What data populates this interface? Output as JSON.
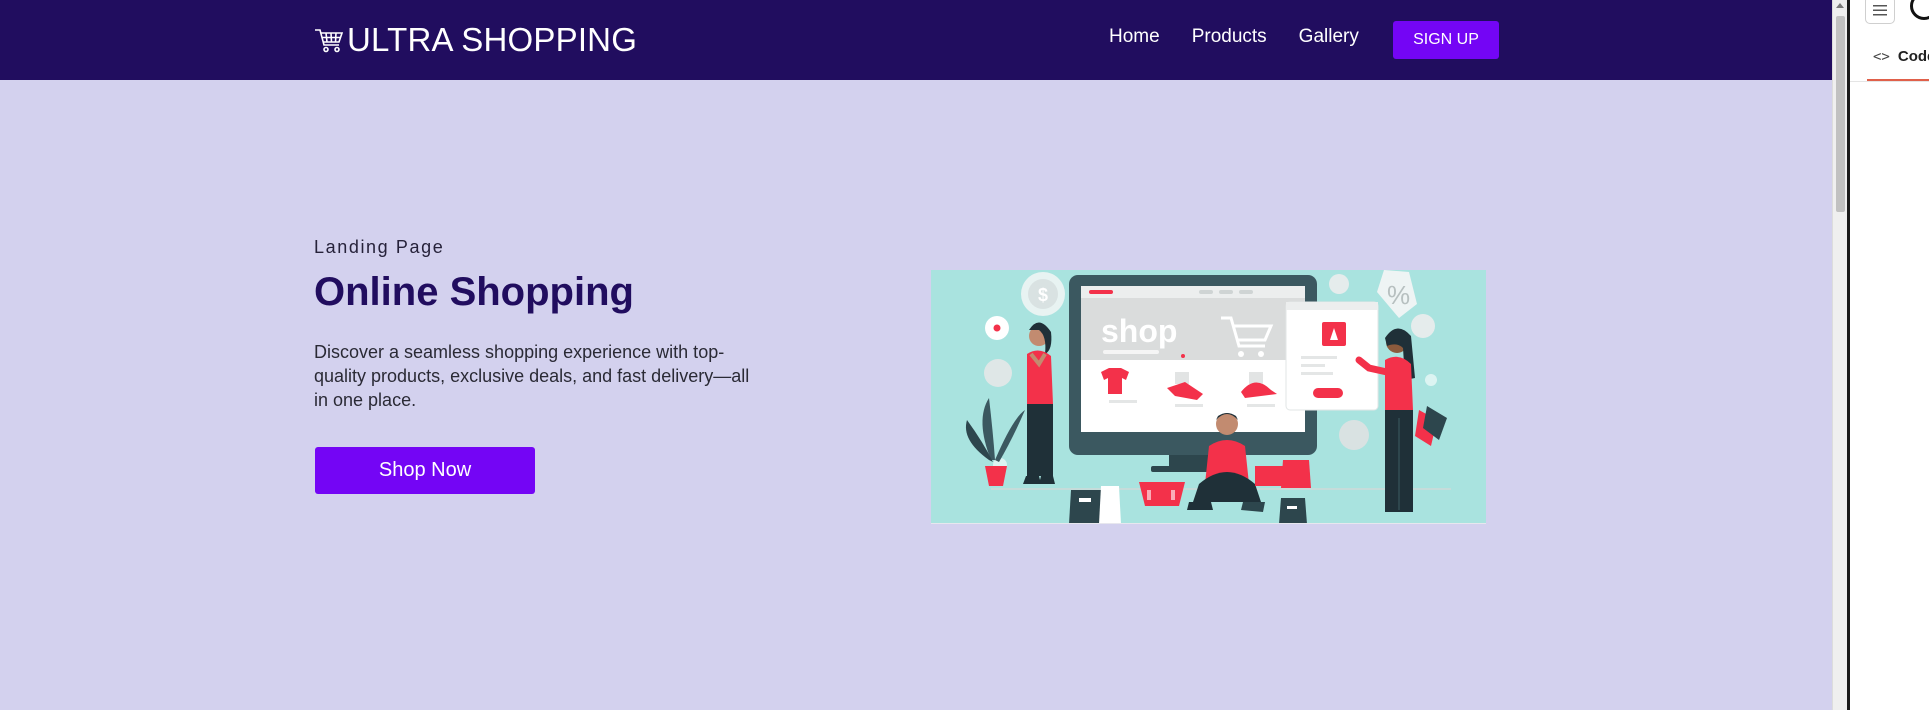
{
  "navbar": {
    "brand_icon": "shopping-cart-icon",
    "brand": "ULTRA SHOPPING",
    "links": [
      {
        "label": "Home"
      },
      {
        "label": "Products"
      },
      {
        "label": "Gallery"
      }
    ],
    "signup": "SIGN UP"
  },
  "hero": {
    "eyebrow": "Landing Page",
    "title": "Online Shopping",
    "description": "Discover a seamless shopping experience with top-quality products, exclusive deals, and fast delivery—all in one place.",
    "cta": "Shop Now",
    "illustration": {
      "screen_text": "shop",
      "badge_text": "%",
      "coin_text": "$"
    }
  },
  "side_panel": {
    "menu_icon": "hamburger-menu-icon",
    "tab_icon": "code-icon",
    "tab_label": "Code"
  },
  "colors": {
    "navbar": "#210d5f",
    "page_bg": "#d3d1ee",
    "accent": "#7405f5",
    "title": "#210d5f",
    "illustration_bg": "#a9e3df",
    "illustration_accent": "#f3314a",
    "tab_underline": "#e0604a"
  }
}
